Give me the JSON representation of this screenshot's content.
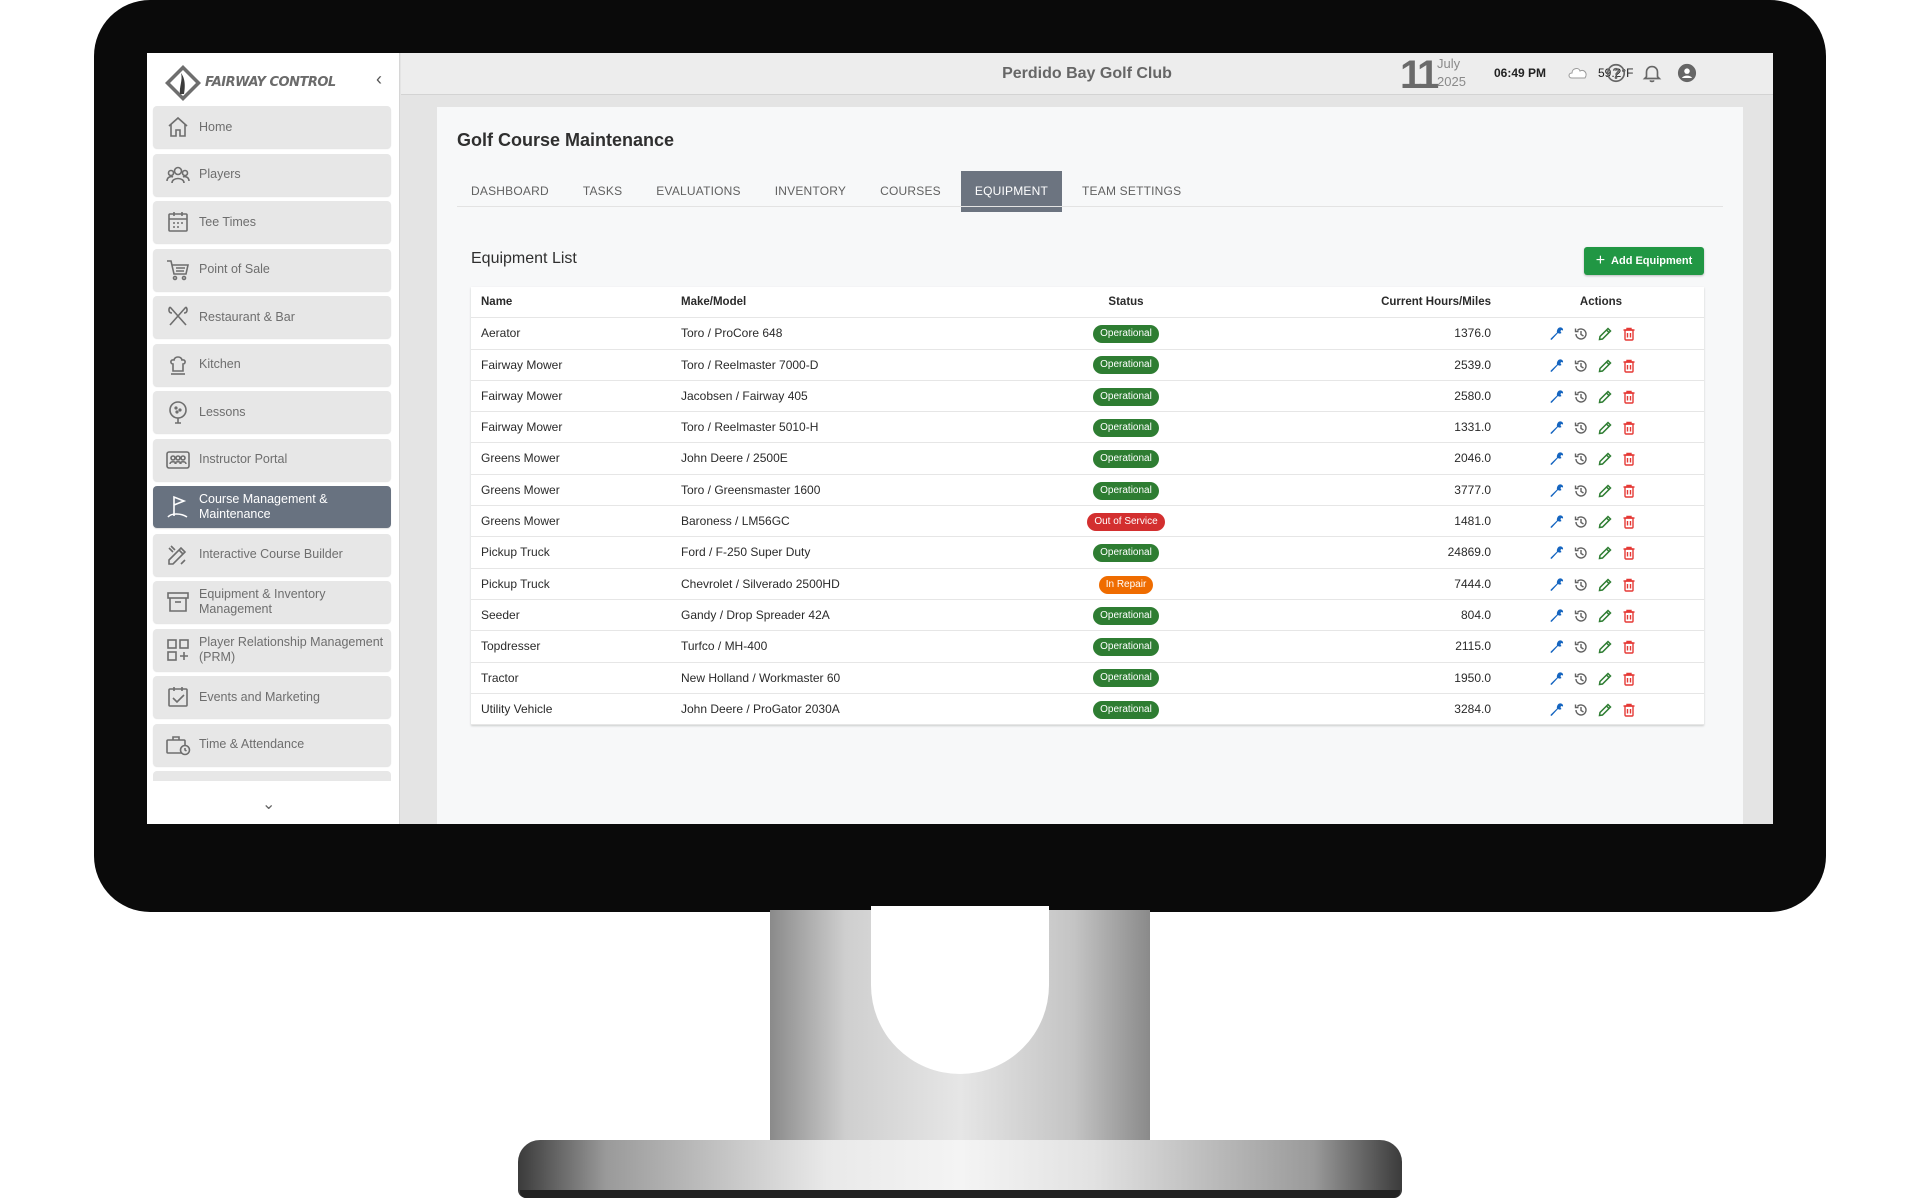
{
  "app": {
    "brand": "FAIRWAY CONTROL",
    "club_name": "Perdido Bay Golf Club"
  },
  "header": {
    "day": "11",
    "month": "July",
    "year": "2025",
    "time": "06:49  PM",
    "temperature": "59.2°F",
    "weather_icon": "cloud-icon"
  },
  "sidebar": {
    "items": [
      {
        "label": "Home",
        "icon": "home-icon"
      },
      {
        "label": "Players",
        "icon": "users-icon"
      },
      {
        "label": "Tee Times",
        "icon": "calendar-icon"
      },
      {
        "label": "Point of Sale",
        "icon": "cart-icon"
      },
      {
        "label": "Restaurant & Bar",
        "icon": "utensils-icon"
      },
      {
        "label": "Kitchen",
        "icon": "chef-icon"
      },
      {
        "label": "Lessons",
        "icon": "golf-ball-icon"
      },
      {
        "label": "Instructor Portal",
        "icon": "id-card-icon"
      },
      {
        "label": "Course Management & Maintenance",
        "icon": "flag-icon",
        "active": true
      },
      {
        "label": "Interactive Course Builder",
        "icon": "pencil-ruler-icon"
      },
      {
        "label": "Equipment & Inventory Management",
        "icon": "archive-icon"
      },
      {
        "label": "Player Relationship Management (PRM)",
        "icon": "grid-plus-icon"
      },
      {
        "label": "Events and Marketing",
        "icon": "calendar-check-icon"
      },
      {
        "label": "Time & Attendance",
        "icon": "briefcase-clock-icon"
      }
    ]
  },
  "page": {
    "title": "Golf Course Maintenance",
    "tabs": [
      {
        "label": "DASHBOARD"
      },
      {
        "label": "TASKS"
      },
      {
        "label": "EVALUATIONS"
      },
      {
        "label": "INVENTORY"
      },
      {
        "label": "COURSES"
      },
      {
        "label": "EQUIPMENT",
        "active": true
      },
      {
        "label": "TEAM SETTINGS"
      }
    ],
    "section_title": "Equipment List",
    "add_button_label": "Add Equipment"
  },
  "table": {
    "columns": [
      "Name",
      "Make/Model",
      "Status",
      "Current Hours/Miles",
      "Actions"
    ],
    "status_colors": {
      "Operational": "#2e7d32",
      "Out of Service": "#d32f2f",
      "In Repair": "#ef6c00"
    },
    "rows": [
      {
        "name": "Aerator",
        "make": "Toro / ProCore 648",
        "status": "Operational",
        "hours": "1376.0"
      },
      {
        "name": "Fairway Mower",
        "make": "Toro / Reelmaster 7000-D",
        "status": "Operational",
        "hours": "2539.0"
      },
      {
        "name": "Fairway Mower",
        "make": "Jacobsen / Fairway 405",
        "status": "Operational",
        "hours": "2580.0"
      },
      {
        "name": "Fairway Mower",
        "make": "Toro / Reelmaster 5010-H",
        "status": "Operational",
        "hours": "1331.0"
      },
      {
        "name": "Greens Mower",
        "make": "John Deere / 2500E",
        "status": "Operational",
        "hours": "2046.0"
      },
      {
        "name": "Greens Mower",
        "make": "Toro / Greensmaster 1600",
        "status": "Operational",
        "hours": "3777.0"
      },
      {
        "name": "Greens Mower",
        "make": "Baroness / LM56GC",
        "status": "Out of Service",
        "hours": "1481.0"
      },
      {
        "name": "Pickup Truck",
        "make": "Ford / F-250 Super Duty",
        "status": "Operational",
        "hours": "24869.0"
      },
      {
        "name": "Pickup Truck",
        "make": "Chevrolet / Silverado 2500HD",
        "status": "In Repair",
        "hours": "7444.0"
      },
      {
        "name": "Seeder",
        "make": "Gandy / Drop Spreader 42A",
        "status": "Operational",
        "hours": "804.0"
      },
      {
        "name": "Topdresser",
        "make": "Turfco / MH-400",
        "status": "Operational",
        "hours": "2115.0"
      },
      {
        "name": "Tractor",
        "make": "New Holland / Workmaster 60",
        "status": "Operational",
        "hours": "1950.0"
      },
      {
        "name": "Utility Vehicle",
        "make": "John Deere / ProGator 2030A",
        "status": "Operational",
        "hours": "3284.0"
      }
    ],
    "action_icons": [
      "wrench-icon",
      "history-icon",
      "edit-icon",
      "delete-icon"
    ],
    "action_colors": [
      "#1565c0",
      "#616161",
      "#2e7d32",
      "#e53935"
    ]
  }
}
